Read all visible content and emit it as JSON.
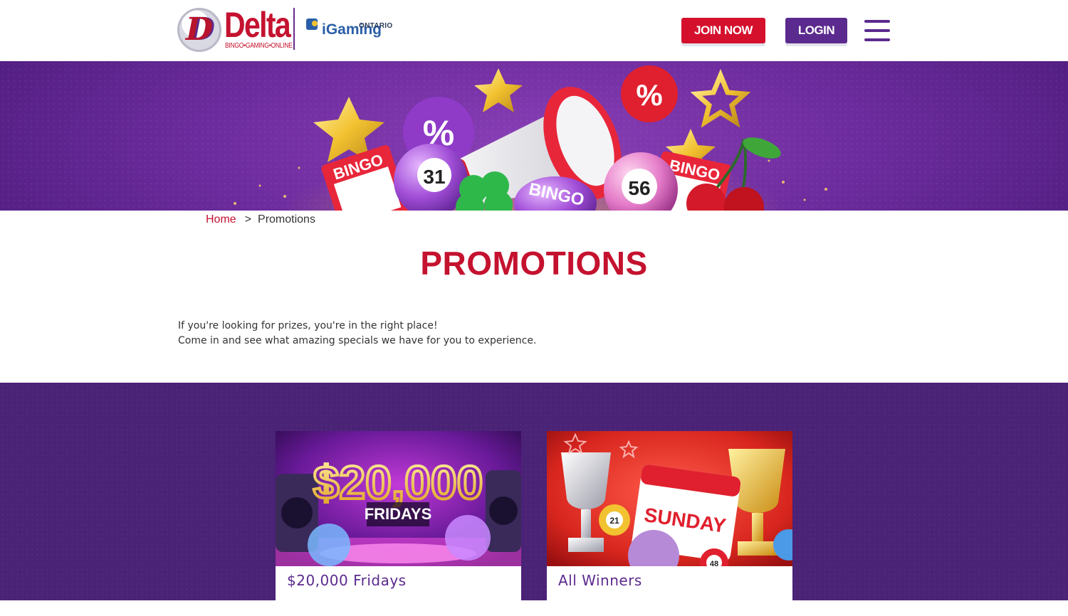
{
  "header": {
    "logo_letter": "D",
    "logo_word": "Delta",
    "logo_tagline": "BINGO•GAMING•ONLINE",
    "partner_word": "iGaming",
    "partner_region": "ONTARIO",
    "join_label": "JOIN NOW",
    "login_label": "LOGIN",
    "menu_icon": "hamburger-menu-icon"
  },
  "hero": {
    "ball_left": "31",
    "ball_right": "56",
    "card_word": "BINGO",
    "percent": "%",
    "sparkle_color": "#ffcf6a"
  },
  "breadcrumb": {
    "home": "Home",
    "separator": ">",
    "current": "Promotions"
  },
  "page": {
    "title": "PROMOTIONS",
    "intro_line1": "If you're looking for prizes, you're in the right place!",
    "intro_line2": "Come in and see what amazing specials we have for you to experience."
  },
  "promotions": [
    {
      "title": "$20,000 Fridays",
      "image_headline": "$20,000",
      "image_subline": "FRIDAYS"
    },
    {
      "title": "All Winners",
      "image_headline": "SUNDAY",
      "ball_a": "21",
      "ball_b": "48"
    }
  ],
  "colors": {
    "brand_red": "#c4122f",
    "brand_purple": "#5b2a8e",
    "section_purple": "#4a2276"
  }
}
